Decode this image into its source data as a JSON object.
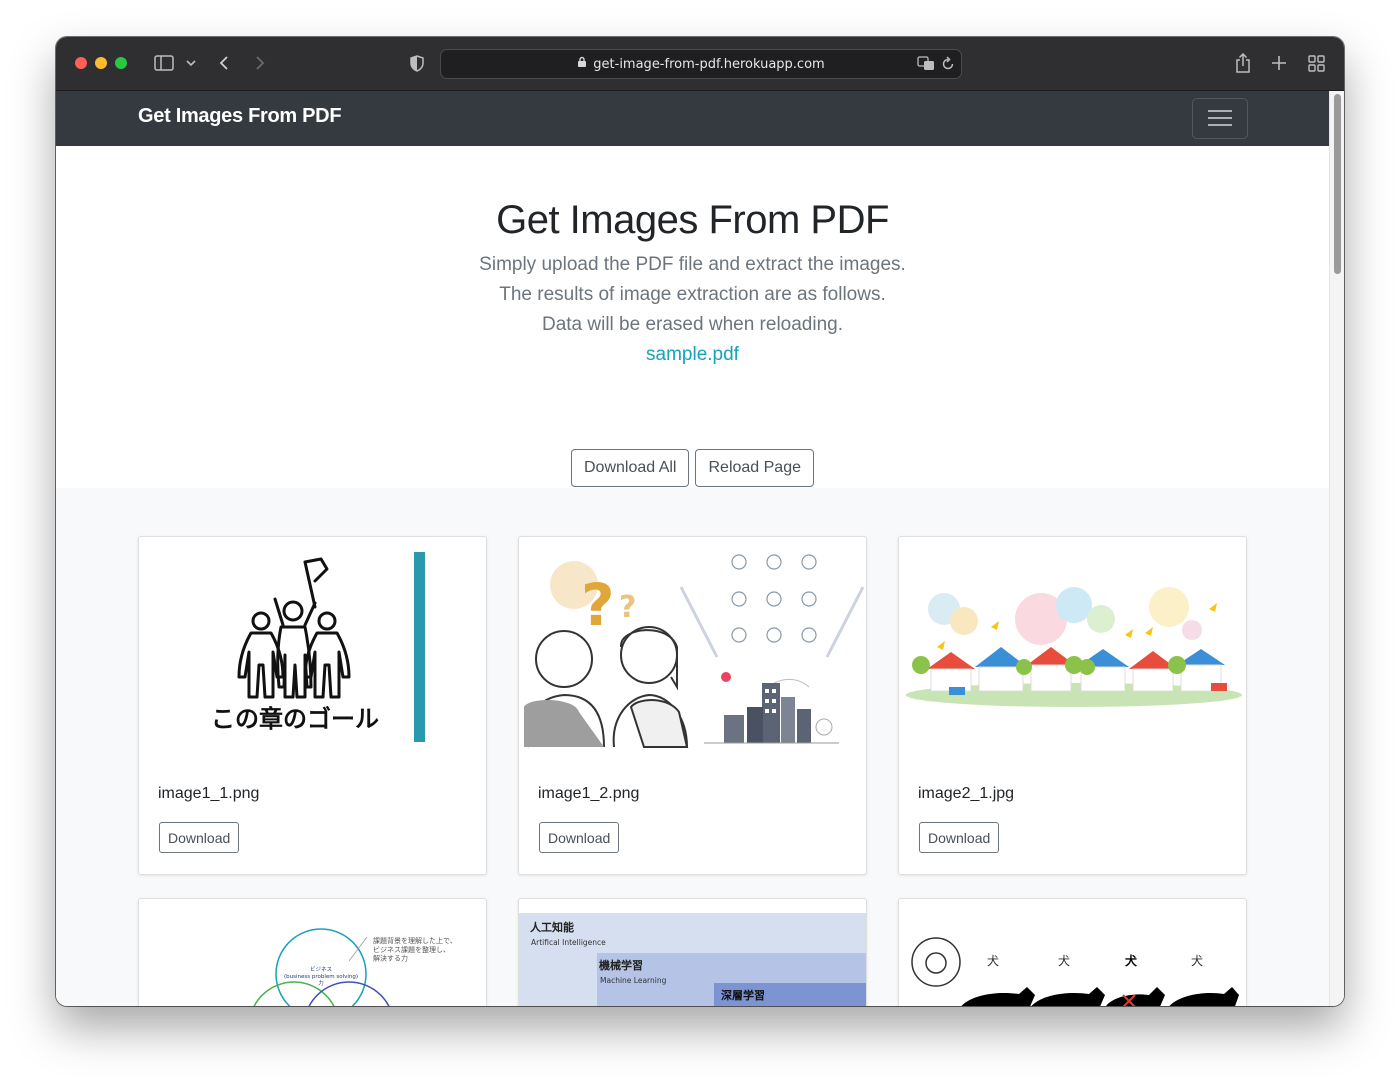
{
  "browser": {
    "url": "get-image-from-pdf.herokuapp.com"
  },
  "navbar": {
    "brand": "Get Images From PDF"
  },
  "hero": {
    "title": "Get Images From PDF",
    "lines": [
      "Simply upload the PDF file and extract the images.",
      "The results of image extraction are as follows.",
      "Data will be erased when reloading."
    ],
    "pdf_link": "sample.pdf",
    "download_all": "Download All",
    "reload_page": "Reload Page"
  },
  "cards": [
    {
      "filename": "image1_1.png",
      "download": "Download",
      "image_text": "この章のゴール"
    },
    {
      "filename": "image1_2.png",
      "download": "Download"
    },
    {
      "filename": "image2_1.jpg",
      "download": "Download"
    },
    {
      "filename": "",
      "download": "",
      "image_text": "ビジネス\n(business problem solving)\n力",
      "note": "課題背景を理解した上で、\nビジネス課題を整理し、\n解決する力"
    },
    {
      "filename": "",
      "download": "",
      "labels": [
        "人工知能",
        "Artifical Intelligence",
        "機械学習",
        "Machine Learning",
        "深層学習"
      ]
    },
    {
      "filename": "",
      "download": "",
      "labels": [
        "犬",
        "犬",
        "犬",
        "犬"
      ]
    }
  ],
  "colors": {
    "navbar": "#343a40",
    "link": "#17a2b8",
    "album_bg": "#f8f9fa",
    "teal_bar": "#2a99ad"
  }
}
